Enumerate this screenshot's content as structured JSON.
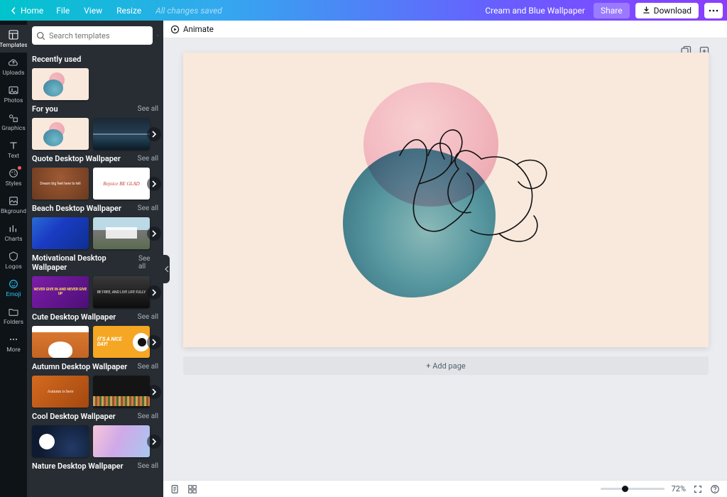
{
  "topbar": {
    "home": "Home",
    "file": "File",
    "view": "View",
    "resize": "Resize",
    "saved": "All changes saved",
    "docname": "Cream and Blue Wallpaper",
    "share": "Share",
    "download": "Download"
  },
  "rail": [
    {
      "id": "templates",
      "label": "Templates",
      "active": true
    },
    {
      "id": "uploads",
      "label": "Uploads"
    },
    {
      "id": "photos",
      "label": "Photos"
    },
    {
      "id": "graphics",
      "label": "Graphics"
    },
    {
      "id": "text",
      "label": "Text"
    },
    {
      "id": "styles",
      "label": "Styles",
      "dot": true
    },
    {
      "id": "bkground",
      "label": "Bkground"
    },
    {
      "id": "charts",
      "label": "Charts"
    },
    {
      "id": "logos",
      "label": "Logos"
    },
    {
      "id": "emoji",
      "label": "Emoji",
      "accent": true
    },
    {
      "id": "folders",
      "label": "Folders"
    },
    {
      "id": "more",
      "label": "More"
    }
  ],
  "search": {
    "placeholder": "Search templates"
  },
  "see_all": "See all",
  "sections": {
    "recent": {
      "title": "Recently used"
    },
    "foryou": {
      "title": "For you"
    },
    "quote": {
      "title": "Quote Desktop Wallpaper"
    },
    "beach": {
      "title": "Beach Desktop Wallpaper"
    },
    "motiv": {
      "title": "Motivational Desktop Wallpaper"
    },
    "cute": {
      "title": "Cute Desktop Wallpaper"
    },
    "autumn": {
      "title": "Autumn Desktop Wallpaper"
    },
    "cool": {
      "title": "Cool Desktop Wallpaper"
    },
    "nature": {
      "title": "Nature Desktop Wallpaper"
    }
  },
  "thumb_text": {
    "brown": "Dream big feet here to tell",
    "white": "Rejoice\nBE GLAD",
    "purple": "NEVER GIVE IN AND\nNEVER GIVE UP",
    "dark": "BE FREE, AND LIVE LIFE FULLY",
    "nice": "IT'S A\nNICE\nDAY!",
    "autumn": "Autumn is here"
  },
  "subheader": {
    "animate": "Animate"
  },
  "add_page": "+ Add page",
  "status": {
    "zoom": "72%"
  },
  "colors": {
    "canvas_bg": "#f9e9dc",
    "pink": "#f2b7be",
    "blue": "#3b7f9a"
  }
}
